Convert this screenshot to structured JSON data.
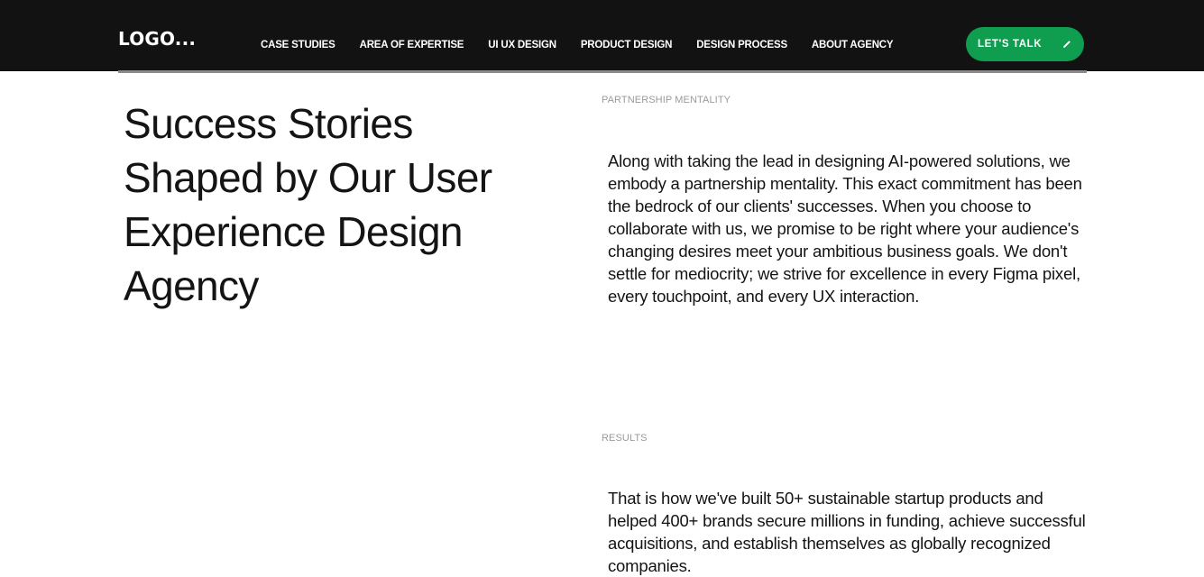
{
  "header": {
    "logo": "LOGO...",
    "nav": [
      {
        "label": "CASE STUDIES"
      },
      {
        "label": "AREA OF EXPERTISE"
      },
      {
        "label": "UI UX DESIGN"
      },
      {
        "label": "PRODUCT DESIGN"
      },
      {
        "label": "DESIGN PROCESS"
      },
      {
        "label": "ABOUT AGENCY"
      }
    ],
    "cta_label": "LET'S TALK",
    "cta_icon": "pencil-icon",
    "background_color": "#121212",
    "cta_color": "#0f9d4f"
  },
  "main": {
    "headline": "Success Stories Shaped by Our User Experience Design Agency",
    "sections": [
      {
        "eyebrow": "PARTNERSHIP MENTALITY",
        "text": "Along with taking the lead in designing AI-powered solutions, we embody a partnership mentality. This exact commitment has been the bedrock of our clients' successes. When you choose to collaborate with us, we promise to be right where your audience's changing desires meet your ambitious business goals. We don't settle for mediocrity; we strive for excellence in every Figma pixel, every touchpoint, and every UX interaction."
      },
      {
        "eyebrow": "RESULTS",
        "text": "That is how we've built 50+ sustainable startup products and helped 400+ brands secure millions in funding, achieve successful acquisitions, and establish themselves as globally recognized companies."
      }
    ]
  }
}
